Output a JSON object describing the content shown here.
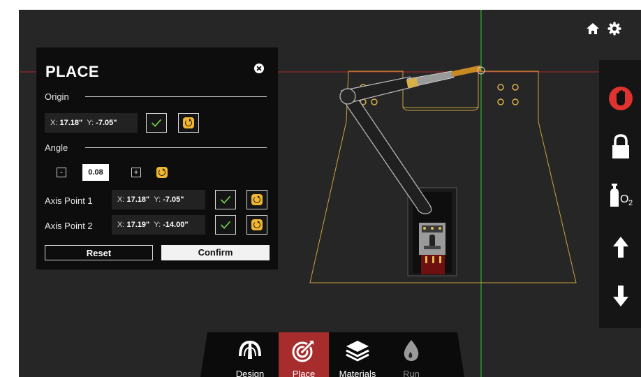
{
  "panel": {
    "title": "PLACE",
    "origin": {
      "label": "Origin",
      "x_label": "X:",
      "x_value": "17.18\"",
      "y_label": "Y:",
      "y_value": "-7.05\""
    },
    "angle": {
      "label": "Angle",
      "decrement": "-",
      "value": "0.08",
      "increment": "+"
    },
    "axis_points": [
      {
        "label": "Axis Point 1",
        "x_label": "X:",
        "x_value": "17.18\"",
        "y_label": "Y:",
        "y_value": "-7.05\""
      },
      {
        "label": "Axis Point 2",
        "x_label": "X:",
        "x_value": "17.19\"",
        "y_label": "Y:",
        "y_value": "-14.00\""
      }
    ],
    "reset_label": "Reset",
    "confirm_label": "Confirm"
  },
  "top_icons": [
    "home-icon",
    "gear-icon"
  ],
  "right_toolbar": [
    "stop-hand-icon",
    "lock-icon",
    "oxygen-tank-icon",
    "arrow-up-icon",
    "arrow-down-icon"
  ],
  "right_toolbar_o2_text": "O",
  "right_toolbar_o2_sub": "2",
  "bottom_nav": {
    "tabs": [
      {
        "label": "Design",
        "icon": "design-gauge-icon",
        "active": false
      },
      {
        "label": "Place",
        "icon": "place-target-icon",
        "active": true
      },
      {
        "label": "Materials",
        "icon": "layers-icon",
        "active": false
      },
      {
        "label": "Run",
        "icon": "flame-icon",
        "active": false
      }
    ]
  },
  "colors": {
    "background": "#262626",
    "panel": "#0d0d0d",
    "accent_red": "#a72d2d",
    "accent_yellow": "#f1b731",
    "check_green": "#6fd34a",
    "outline_yellow": "#c9a33d",
    "crosshair_green": "#3ccb3c",
    "crosshair_red": "#b02a2a"
  }
}
